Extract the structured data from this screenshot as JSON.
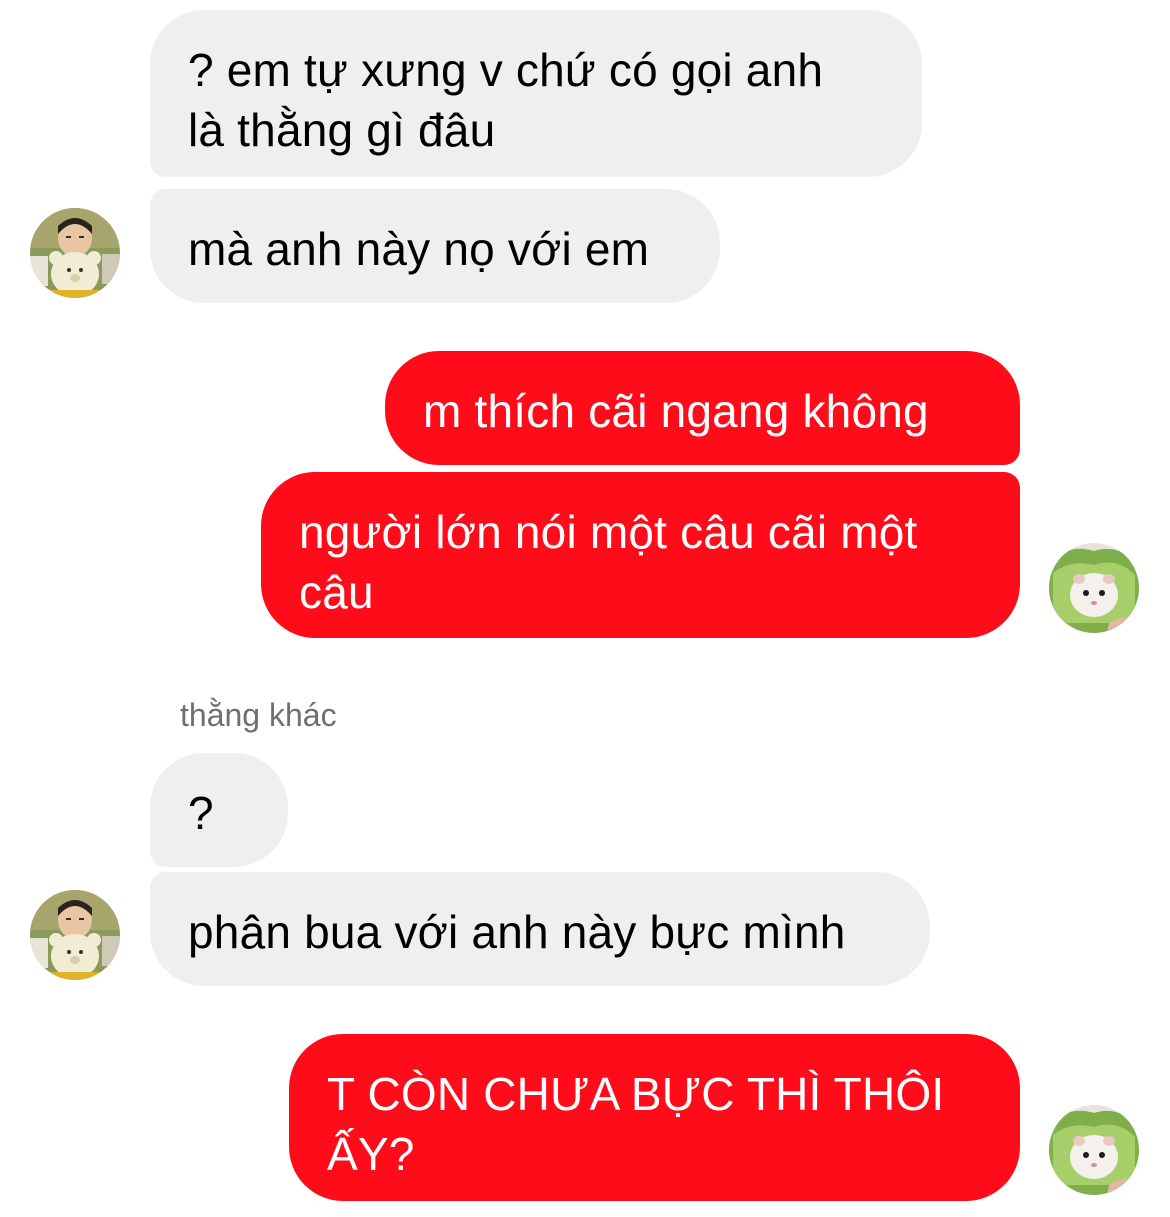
{
  "conversation": {
    "messages": [
      {
        "direction": "incoming",
        "text": "? em tự xưng v chứ có gọi anh\nlà thằng gì đâu"
      },
      {
        "direction": "incoming",
        "text": "mà anh này nọ với em"
      },
      {
        "direction": "outgoing",
        "text": "m thích cãi ngang không"
      },
      {
        "direction": "outgoing",
        "text": "người lớn nói một câu cãi một\ncâu"
      },
      {
        "direction": "incoming",
        "text": "?"
      },
      {
        "direction": "incoming",
        "text": "phân bua với anh này bực mình"
      },
      {
        "direction": "outgoing",
        "text": "T CÒN CHƯA BỰC THÌ THÔI\nẤY?"
      }
    ],
    "sender_name": "thằng khác"
  },
  "colors": {
    "incoming_bubble": "#efeff1",
    "outgoing_bubble": "#ff0b1a",
    "outgoing_text": "#ffffff",
    "sender_name": "#6e6e73"
  },
  "avatars": {
    "contact": "boy-with-teddy-bear-avatar",
    "self": "hamster-in-lettuce-avatar"
  }
}
